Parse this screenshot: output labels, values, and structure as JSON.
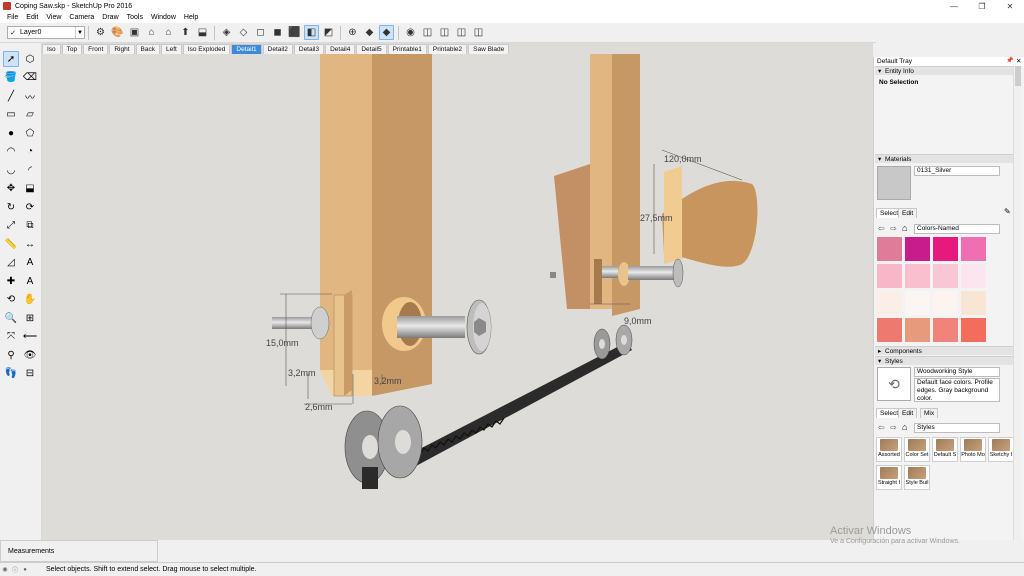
{
  "window": {
    "title": "Coping Saw.skp - SketchUp Pro 2016",
    "minimize": "—",
    "maximize": "❐",
    "close": "✕"
  },
  "menu": [
    "File",
    "Edit",
    "View",
    "Camera",
    "Draw",
    "Tools",
    "Window",
    "Help"
  ],
  "layer": {
    "check": "✓",
    "name": "Layer0"
  },
  "toolbar_icons": [
    "components-icon",
    "materials-icon",
    "model-info-icon",
    "warehouse-icon",
    "3d-house-icon",
    "share-icon",
    "export-icon",
    "xray-icon",
    "backedges-icon",
    "wireframe-icon",
    "hidden-line-icon",
    "shaded-icon",
    "textured-icon",
    "monochrome-icon",
    "section-plane-icon",
    "section-display-icon",
    "section-cut-icon",
    "zoom-ext-icon",
    "iso-view-icon",
    "top-view-icon",
    "front-view-icon",
    "right-view-icon",
    "back-view-icon"
  ],
  "scene_tabs": [
    "Iso",
    "Top",
    "Front",
    "Right",
    "Back",
    "Left",
    "Iso Exploded",
    "Detail1",
    "Detail2",
    "Detail3",
    "Detail4",
    "Detail5",
    "Printable1",
    "Printable2",
    "Saw Blade"
  ],
  "selected_scene": "Detail1",
  "dimensions": {
    "top_width": "120,0mm",
    "top_height": "27,5mm",
    "bolt_len": "15,0mm",
    "slot_a": "3,2mm",
    "slot_b": "3,2mm",
    "blade": "2,6mm",
    "gap": "9,0mm"
  },
  "tray": {
    "title": "Default Tray",
    "pin": "📌",
    "close": "✕",
    "entity_info": {
      "header": "Entity Info",
      "value": "No Selection"
    },
    "materials": {
      "header": "Materials",
      "name": "0131_Silver",
      "tab_select": "Select",
      "tab_edit": "Edit",
      "collection": "Colors-Named",
      "swatches": [
        "#e07b9a",
        "#c81b8c",
        "#e8197d",
        "#ef6fb3",
        "#f7b7c8",
        "#f9bfcf",
        "#f9c6d6",
        "#fbe5ee",
        "#fbeee6",
        "#faf6f4",
        "#fbf4f1",
        "#f8e5d3",
        "#ec7a6e",
        "#e79b7d",
        "#f0847a",
        "#f36d5c"
      ]
    },
    "components": {
      "header": "Components"
    },
    "styles": {
      "header": "Styles",
      "name": "Woodworking Style",
      "description": "Default face colors. Profile edges. Gray background color.",
      "tab_select": "Select",
      "tab_edit": "Edit",
      "tab_mix": "Mix",
      "collection": "Styles",
      "items": [
        "Assorted",
        "Color Set",
        "Default S",
        "Photo Mo",
        "Sketchy I",
        "Straight I",
        "Style Buil"
      ]
    }
  },
  "measurements_label": "Measurements",
  "status_text": "Select objects. Shift to extend select. Drag mouse to select multiple.",
  "watermark": {
    "line1": "Activar Windows",
    "line2": "Ve a Configuración para activar Windows."
  }
}
